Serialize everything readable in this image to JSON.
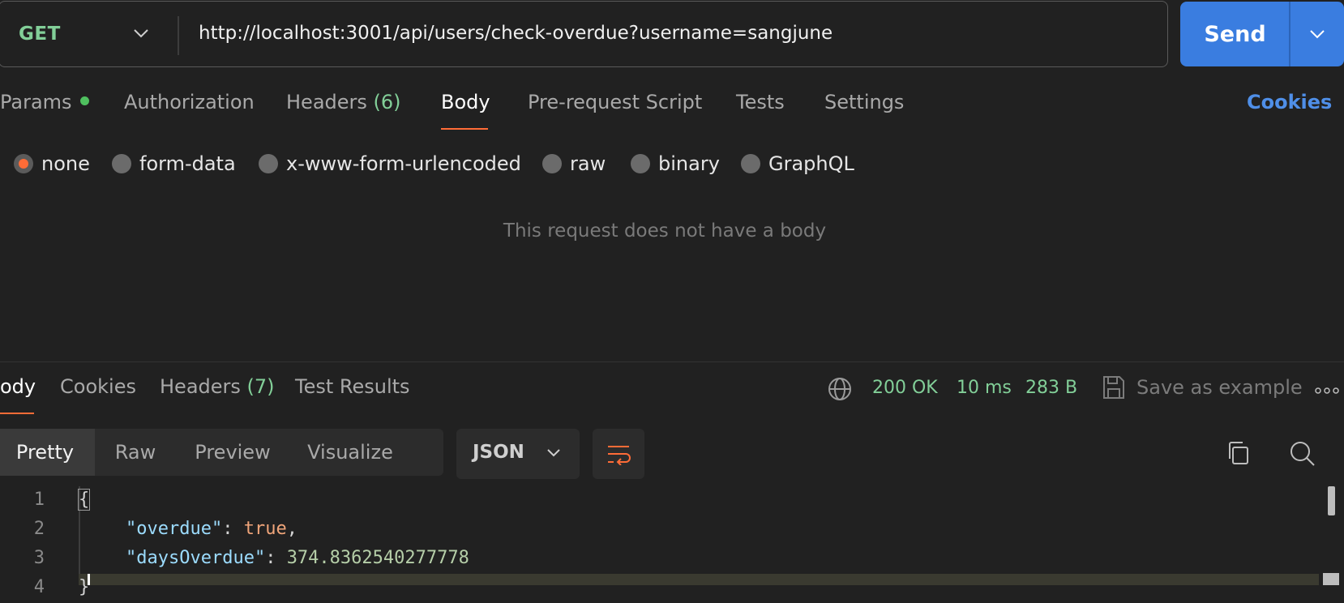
{
  "request": {
    "method": "GET",
    "url": "http://localhost:3001/api/users/check-overdue?username=sangjune",
    "send_label": "Send"
  },
  "request_tabs": [
    {
      "label": "Params"
    },
    {
      "label": "Authorization"
    },
    {
      "label": "Headers",
      "count": "(6)"
    },
    {
      "label": "Body"
    },
    {
      "label": "Pre-request Script"
    },
    {
      "label": "Tests"
    },
    {
      "label": "Settings"
    }
  ],
  "cookies_label": "Cookies",
  "body_types": [
    "none",
    "form-data",
    "x-www-form-urlencoded",
    "raw",
    "binary",
    "GraphQL"
  ],
  "no_body_message": "This request does not have a body",
  "response_tabs": [
    {
      "label": "ody"
    },
    {
      "label": "Cookies"
    },
    {
      "label": "Headers",
      "count": "(7)"
    },
    {
      "label": "Test Results"
    }
  ],
  "response_status": {
    "code": "200 OK",
    "time": "10 ms",
    "size": "283 B",
    "save_label": "Save as example"
  },
  "view_modes": [
    "Pretty",
    "Raw",
    "Preview",
    "Visualize"
  ],
  "format": "JSON",
  "code_lines": [
    {
      "no": "1",
      "text": "{"
    },
    {
      "no": "2",
      "key": "\"overdue\"",
      "colon": ": ",
      "value": "true",
      "trail": ","
    },
    {
      "no": "3",
      "key": "\"daysOverdue\"",
      "colon": ": ",
      "value": "374.8362540277778",
      "trail": ""
    },
    {
      "no": "4",
      "text": "}"
    }
  ],
  "colors": {
    "accent": "#ff6c37",
    "send_blue": "#3a7de0",
    "success_green": "#82cf98",
    "link_blue": "#4f8fe8"
  }
}
